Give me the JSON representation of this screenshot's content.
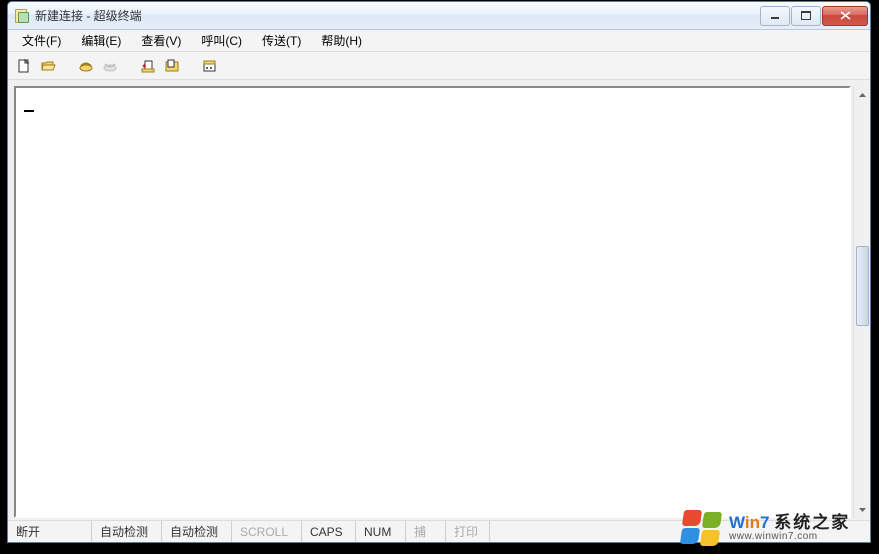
{
  "window": {
    "title": "新建连接 - 超级终端"
  },
  "menubar": {
    "items": [
      {
        "label": "文件(F)"
      },
      {
        "label": "编辑(E)"
      },
      {
        "label": "查看(V)"
      },
      {
        "label": "呼叫(C)"
      },
      {
        "label": "传送(T)"
      },
      {
        "label": "帮助(H)"
      }
    ]
  },
  "toolbar": {
    "icons": {
      "new": "new-file-icon",
      "open": "open-folder-icon",
      "call": "phone-call-icon",
      "hangup": "phone-hangup-icon",
      "send": "send-file-icon",
      "receive": "receive-file-icon",
      "properties": "properties-icon"
    }
  },
  "statusbar": {
    "connection": "断开",
    "autodetect1": "自动检测",
    "autodetect2": "自动检测",
    "scroll": "SCROLL",
    "caps": "CAPS",
    "num": "NUM",
    "capture": "捕",
    "print": "打印"
  },
  "watermark": {
    "line1_a": "W",
    "line1_b": "in",
    "line1_c": "7",
    "line1_d": "系统之家",
    "line2": "www.winwin7.com"
  }
}
